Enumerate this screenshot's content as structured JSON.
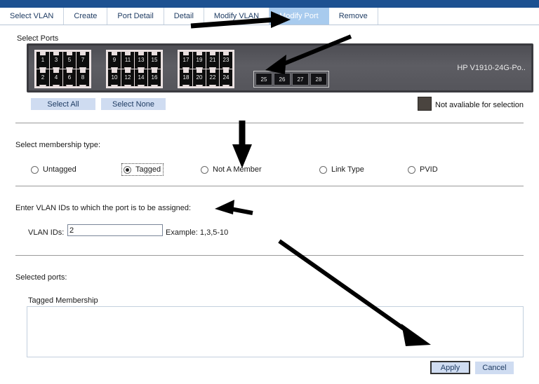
{
  "header": {
    "band_color": "#1d5191"
  },
  "tabs": [
    {
      "label": "Select VLAN",
      "active": false
    },
    {
      "label": "Create",
      "active": false
    },
    {
      "label": "Port Detail",
      "active": false
    },
    {
      "label": "Detail",
      "active": false
    },
    {
      "label": "Modify VLAN",
      "active": false
    },
    {
      "label": "Modify Port",
      "active": true
    },
    {
      "label": "Remove",
      "active": false
    }
  ],
  "select_ports": {
    "title": "Select Ports",
    "device_model": "HP V1910-24G-Po..",
    "port_groups": [
      {
        "top": [
          "1",
          "3",
          "5",
          "7"
        ],
        "bottom": [
          "2",
          "4",
          "6",
          "8"
        ]
      },
      {
        "top": [
          "9",
          "11",
          "13",
          "15"
        ],
        "bottom": [
          "10",
          "12",
          "14",
          "16"
        ]
      },
      {
        "top": [
          "17",
          "19",
          "21",
          "23"
        ],
        "bottom": [
          "18",
          "20",
          "22",
          "24"
        ]
      }
    ],
    "sfp_ports": [
      "25",
      "26",
      "27",
      "28"
    ],
    "select_all_label": "Select All",
    "select_none_label": "Select None",
    "legend_text": "Not avaliable for selection",
    "legend_color": "#4a443f"
  },
  "membership": {
    "title": "Select membership type:",
    "options": [
      {
        "label": "Untagged",
        "checked": false
      },
      {
        "label": "Tagged",
        "checked": true
      },
      {
        "label": "Not A Member",
        "checked": false
      },
      {
        "label": "Link Type",
        "checked": false
      },
      {
        "label": "PVID",
        "checked": false
      }
    ]
  },
  "vlan": {
    "instruction": "Enter VLAN IDs to which the port is to be assigned:",
    "field_label": "VLAN IDs:",
    "value": "2",
    "placeholder": "",
    "example": "Example: 1,3,5-10"
  },
  "selected_ports": {
    "title": "Selected ports:",
    "membership_label": "Tagged Membership",
    "membership_value": ""
  },
  "actions": {
    "apply_label": "Apply",
    "cancel_label": "Cancel"
  }
}
